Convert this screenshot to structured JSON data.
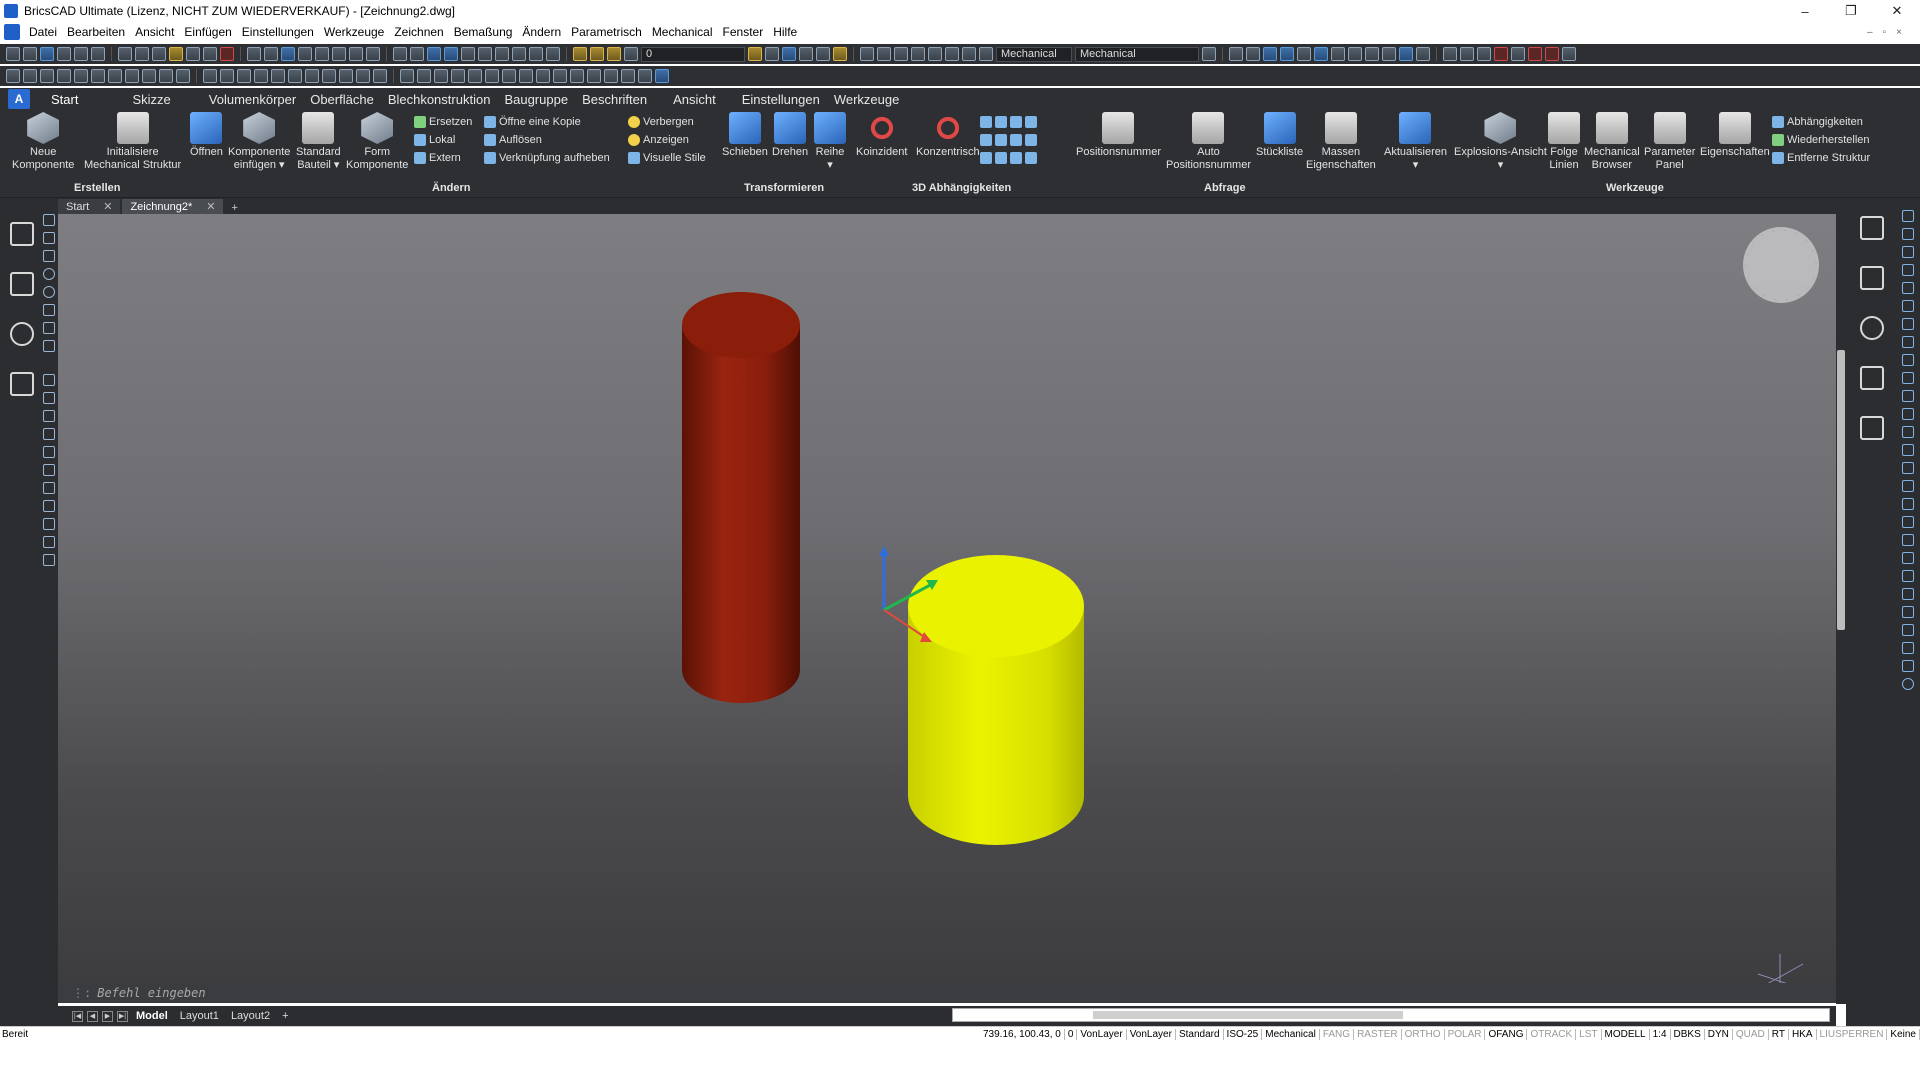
{
  "window": {
    "title": "BricsCAD Ultimate (Lizenz, NICHT ZUM WIEDERVERKAUF) - [Zeichnung2.dwg]",
    "minimize": "–",
    "maximize": "❐",
    "close": "✕"
  },
  "menu": {
    "items": [
      "Datei",
      "Bearbeiten",
      "Ansicht",
      "Einfügen",
      "Einstellungen",
      "Werkzeuge",
      "Zeichnen",
      "Bemaßung",
      "Ändern",
      "Parametrisch",
      "Mechanical",
      "Fenster",
      "Hilfe"
    ],
    "right": [
      "–",
      "▫",
      "×"
    ]
  },
  "toolbar": {
    "layer_value": "0",
    "workspace1": "Mechanical",
    "workspace2": "Mechanical"
  },
  "ribbon_tabs": [
    "Start",
    "Skizze",
    "Volumenkörper",
    "Oberfläche",
    "Blechkonstruktion",
    "Baugruppe",
    "Beschriften",
    "Ansicht",
    "Einstellungen",
    "Werkzeuge"
  ],
  "ribbon": {
    "buttons": {
      "neue_komponente": [
        "Neue",
        "Komponente"
      ],
      "initialisiere": [
        "Initialisiere",
        "Mechanical Struktur"
      ],
      "oeffnen": [
        "Öffnen"
      ],
      "komponente_einfuegen": [
        "Komponente",
        "einfügen ▾"
      ],
      "standard_bauteil": [
        "Standard",
        "Bauteil ▾"
      ],
      "form_komponente": [
        "Form",
        "Komponente"
      ],
      "schieben": [
        "Schieben"
      ],
      "drehen": [
        "Drehen"
      ],
      "reihe": [
        "Reihe",
        "▾"
      ],
      "koinzident": [
        "Koinzident"
      ],
      "konzentrisch": [
        "Konzentrisch"
      ],
      "positionsnummer": [
        "Positionsnummer"
      ],
      "auto_positionsnummer": [
        "Auto",
        "Positionsnummer"
      ],
      "stueckliste": [
        "Stückliste"
      ],
      "massen_eigenschaften": [
        "Massen",
        "Eigenschaften"
      ],
      "aktualisieren": [
        "Aktualisieren",
        "▾"
      ],
      "explosions_ansicht": [
        "Explosions-Ansicht",
        "▾"
      ],
      "folge_linien": [
        "Folge",
        "Linien"
      ],
      "mechanical_browser": [
        "Mechanical",
        "Browser"
      ],
      "parameter_panel": [
        "Parameter",
        "Panel"
      ],
      "eigenschaften": [
        "Eigenschaften"
      ]
    },
    "aendern_small1": [
      "Ersetzen",
      "Lokal",
      "Extern"
    ],
    "aendern_small2": [
      "Öffne eine Kopie",
      "Auflösen",
      "Verknüpfung aufheben"
    ],
    "aendern_small3": [
      "Verbergen",
      "Anzeigen",
      "Visuelle Stile"
    ],
    "werkzeuge_small": [
      "Abhängigkeiten",
      "Wiederherstellen",
      "Entferne Struktur"
    ],
    "panel_titles": {
      "erstellen": "Erstellen",
      "aendern": "Ändern",
      "transformieren": "Transformieren",
      "abhaengigkeiten": "3D Abhängigkeiten",
      "abfrage": "Abfrage",
      "werkzeuge": "Werkzeuge"
    }
  },
  "doc_tabs": [
    {
      "label": "Start",
      "close": "✕"
    },
    {
      "label": "Zeichnung2*",
      "close": "✕"
    }
  ],
  "doc_tabs_add": "+",
  "viewport": {
    "cylinder_red_color": "#8a1a0a",
    "cylinder_yellow_color": "#e6ee00"
  },
  "command": {
    "grip": "⋮:",
    "placeholder": "Befehl eingeben"
  },
  "layout_tabs": {
    "nav": [
      "|◀",
      "◀",
      "▶",
      "▶|"
    ],
    "tabs": [
      "Model",
      "Layout1",
      "Layout2",
      "+"
    ]
  },
  "statusbar": {
    "ready": "Bereit",
    "items": [
      "739.16, 100.43, 0",
      "0",
      "VonLayer",
      "VonLayer",
      "Standard",
      "ISO-25",
      "Mechanical",
      "FANG",
      "RASTER",
      "ORTHO",
      "POLAR",
      "OFANG",
      "OTRACK",
      "LST",
      "MODELL",
      "1:4",
      "DBKS",
      "DYN",
      "QUAD",
      "RT",
      "HKA",
      "LIUSPERREN",
      "Keine"
    ],
    "off_items": [
      "FANG",
      "RASTER",
      "ORTHO",
      "POLAR",
      "OTRACK",
      "LST",
      "QUAD",
      "LIUSPERREN"
    ]
  }
}
